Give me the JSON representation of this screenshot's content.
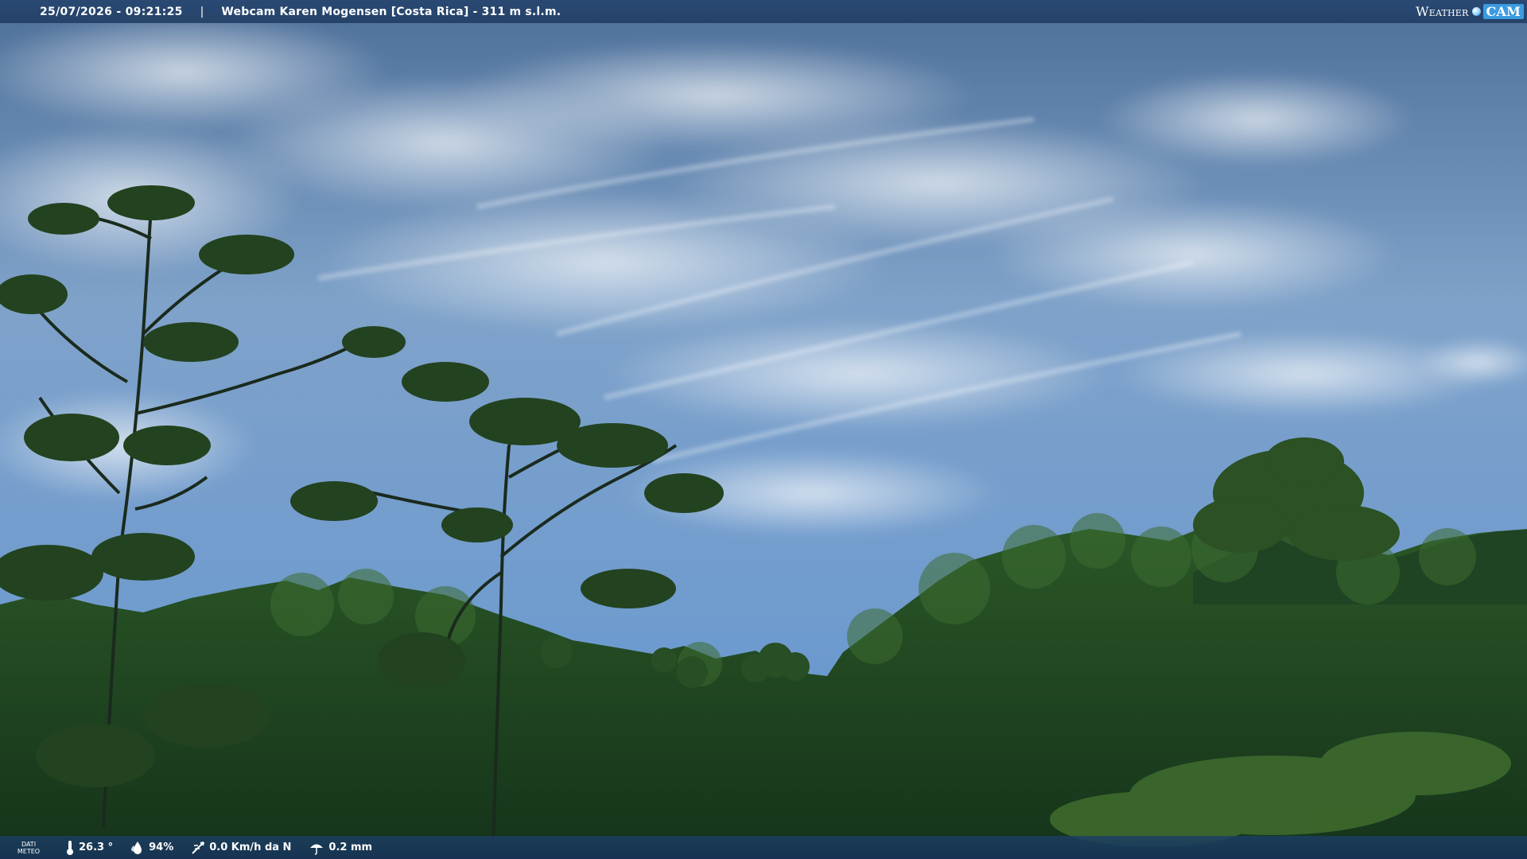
{
  "header": {
    "datetime": "25/07/2026 - 09:21:25",
    "separator": "|",
    "title": "Webcam Karen Mogensen [Costa Rica] - 311 m s.l.m."
  },
  "brand": {
    "weather": "Weather",
    "cam": "CAM"
  },
  "weather": {
    "label_line1": "DATI",
    "label_line2": "METEO",
    "temperature": "26.3 °",
    "humidity": "94%",
    "wind": "0.0 Km/h da N",
    "rain": "0.2 mm"
  },
  "colors": {
    "sky_top": "#4d6f99",
    "sky_mid": "#7fa2c9",
    "sky_horizon": "#5f8fc6",
    "forest_dark": "#15331a",
    "forest_mid": "#2c5a28",
    "forest_light": "#4c7c36",
    "bar": "#1e3a60"
  },
  "icons": [
    "thermometer-icon",
    "humidity-drop-icon",
    "wind-icon",
    "rain-icon"
  ]
}
